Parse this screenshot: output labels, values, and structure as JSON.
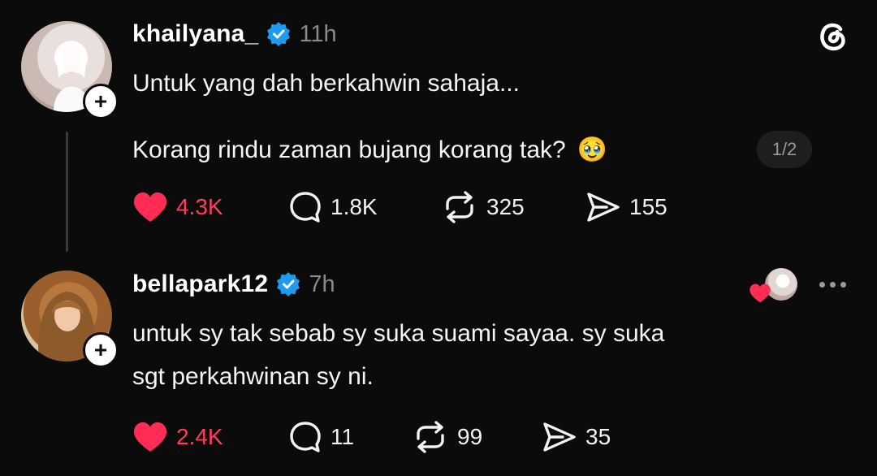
{
  "post": {
    "username": "khailyana_",
    "time": "11h",
    "line1": "Untuk yang dah berkahwin sahaja...",
    "line2": "Korang rindu zaman bujang korang tak?",
    "emoji": "🥹",
    "page_indicator": "1/2",
    "likes": "4.3K",
    "replies": "1.8K",
    "reposts": "325",
    "shares": "155"
  },
  "reply": {
    "username": "bellapark12",
    "time": "7h",
    "line1": "untuk sy tak sebab sy suka suami sayaa. sy suka",
    "line2": "sgt perkahwinan sy ni.",
    "likes": "2.4K",
    "replies": "11",
    "reposts": "99",
    "shares": "35"
  },
  "colors": {
    "background": "#0b0b0b",
    "like_red": "#ff3d5a",
    "verified_blue": "#1d9bf0",
    "muted": "#8a8a8a"
  },
  "icons": [
    "threads-logo-icon",
    "verified-icon",
    "heart-icon",
    "reply-icon",
    "repost-icon",
    "share-icon",
    "more-icon",
    "plus-icon"
  ]
}
